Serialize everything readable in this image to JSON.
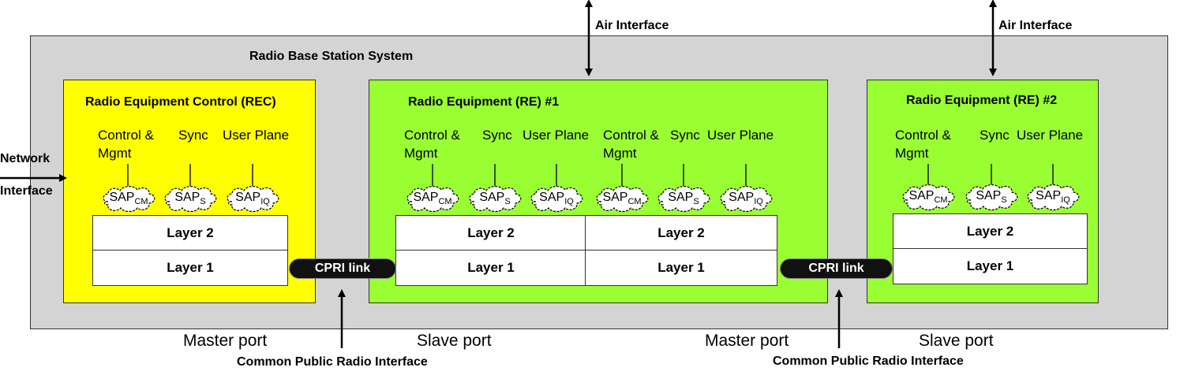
{
  "system": {
    "title": "Radio Base Station System"
  },
  "air_interface": {
    "left": "Air Interface",
    "right": "Air  Interface"
  },
  "network_interface": {
    "line1": "Network",
    "line2": "Interface"
  },
  "rec": {
    "title": "Radio Equipment Control (REC)",
    "planes": {
      "control_l1": "Control &",
      "control_l2": "Mgmt",
      "sync": "Sync",
      "user": "User Plane"
    },
    "saps": [
      {
        "base": "SAP",
        "sub": "CM"
      },
      {
        "base": "SAP",
        "sub": "S"
      },
      {
        "base": "SAP",
        "sub": "IQ"
      }
    ],
    "layer2": "Layer 2",
    "layer1": "Layer 1"
  },
  "re1": {
    "title": "Radio Equipment (RE) #1",
    "planes": [
      {
        "control_l1": "Control &",
        "control_l2": "Mgmt",
        "sync": "Sync",
        "user": "User Plane"
      },
      {
        "control_l1": "Control &",
        "control_l2": "Mgmt",
        "sync": "Sync",
        "user": "User Plane"
      }
    ],
    "saps": [
      {
        "base": "SAP",
        "sub": "CM"
      },
      {
        "base": "SAP",
        "sub": "S"
      },
      {
        "base": "SAP",
        "sub": "IQ"
      },
      {
        "base": "SAP",
        "sub": "CM"
      },
      {
        "base": "SAP",
        "sub": "S"
      },
      {
        "base": "SAP",
        "sub": "IQ"
      }
    ],
    "layer2": [
      "Layer 2",
      "Layer 2"
    ],
    "layer1": [
      "Layer 1",
      "Layer 1"
    ]
  },
  "re2": {
    "title": "Radio Equipment (RE) #2",
    "planes": {
      "control_l1": "Control &",
      "control_l2": "Mgmt",
      "sync": "Sync",
      "user": "User Plane"
    },
    "saps": [
      {
        "base": "SAP",
        "sub": "CM"
      },
      {
        "base": "SAP",
        "sub": "S"
      },
      {
        "base": "SAP",
        "sub": "IQ"
      }
    ],
    "layer2": "Layer 2",
    "layer1": "Layer 1"
  },
  "cpri_links": [
    "CPRI link",
    "CPRI link"
  ],
  "ports": {
    "master_1": "Master port",
    "slave_1": "Slave port",
    "master_2": "Master port",
    "slave_2": "Slave port"
  },
  "cpri_interface": [
    "Common Public Radio Interface",
    "Common Public Radio Interface"
  ]
}
